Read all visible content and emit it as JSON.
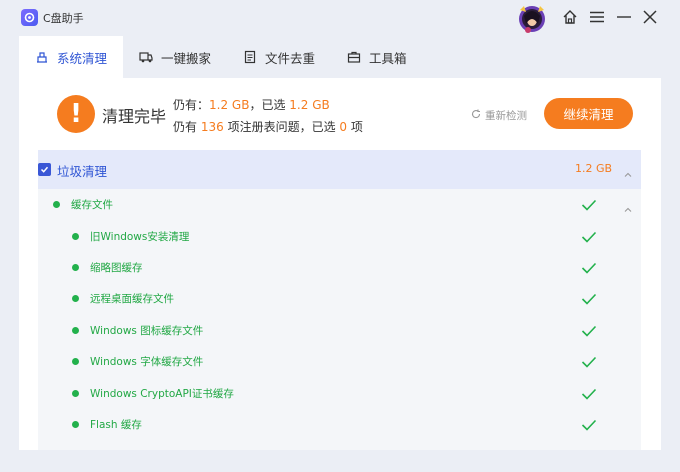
{
  "app": {
    "title": "C盘助手"
  },
  "tabs": [
    {
      "label": "系统清理",
      "icon": "broom-icon",
      "active": true
    },
    {
      "label": "一键搬家",
      "icon": "truck-icon",
      "active": false
    },
    {
      "label": "文件去重",
      "icon": "document-icon",
      "active": false
    },
    {
      "label": "工具箱",
      "icon": "toolbox-icon",
      "active": false
    }
  ],
  "summary": {
    "title": "清理完毕",
    "line1_prefix": "仍有：",
    "remaining_size": "1.2 GB",
    "line1_mid": "，已选",
    "selected_size": "1.2 GB",
    "line2_prefix": "仍有",
    "registry_issue_count": "136",
    "line2_mid": "项注册表问题，已选",
    "selected_issue_count": "0",
    "line2_suffix": "项",
    "recheck_label": "重新检测",
    "continue_label": "继续清理"
  },
  "category": {
    "label": "垃圾清理",
    "size": "1.2 GB",
    "checked": true
  },
  "subcategory": {
    "label": "缓存文件"
  },
  "items": [
    {
      "label": "旧Windows安装清理"
    },
    {
      "label": "缩略图缓存"
    },
    {
      "label": "远程桌面缓存文件"
    },
    {
      "label": "Windows 图标缓存文件"
    },
    {
      "label": "Windows 字体缓存文件"
    },
    {
      "label": "Windows CryptoAPI证书缓存"
    },
    {
      "label": "Flash 缓存"
    }
  ],
  "colors": {
    "accent_blue": "#2f55d4",
    "accent_orange": "#f57c1f",
    "success_green": "#22b14c"
  }
}
